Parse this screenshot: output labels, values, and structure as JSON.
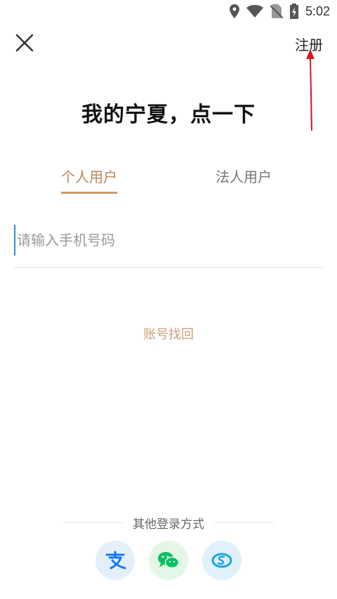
{
  "status_bar": {
    "time": "5:02",
    "icons": [
      "location-icon",
      "wifi-icon",
      "no-sim-icon",
      "battery-charging-icon"
    ]
  },
  "header": {
    "close_icon": "close-icon",
    "register_label": "注册"
  },
  "title": "我的宁夏，点一下",
  "tabs": [
    {
      "label": "个人用户",
      "active": true
    },
    {
      "label": "法人用户",
      "active": false
    }
  ],
  "phone_input": {
    "value": "",
    "placeholder": "请输入手机号码"
  },
  "account_recovery_label": "账号找回",
  "other_login": {
    "label": "其他登录方式",
    "methods": [
      "alipay-icon",
      "wechat-icon",
      "social-security-icon"
    ]
  },
  "colors": {
    "accent": "#c49a72",
    "annotation_arrow": "#d9141e",
    "alipay": "#1677ff",
    "wechat": "#07c160",
    "social": "#1aa6e0"
  }
}
